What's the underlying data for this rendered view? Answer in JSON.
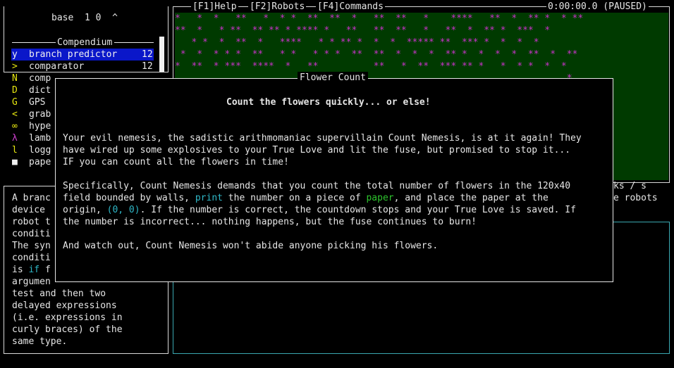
{
  "top_left": {
    "title": "base  1 0  ^"
  },
  "topbar": {
    "help": "[F1]Help",
    "robots": "[F2]Robots",
    "commands": "[F4]Commands",
    "clock": "0:00:00.0 (PAUSED)"
  },
  "compendium": {
    "title": "Compendium",
    "items": [
      {
        "glyph": "y",
        "label": "branch predictor",
        "count": "12"
      },
      {
        "glyph": ">",
        "label": "comparator",
        "count": "12"
      },
      {
        "glyph": "N",
        "label": "comp",
        "count": ""
      },
      {
        "glyph": "D",
        "label": "dict",
        "count": ""
      },
      {
        "glyph": "G",
        "label": "GPS",
        "count": ""
      },
      {
        "glyph": "<",
        "label": "grab",
        "count": ""
      },
      {
        "glyph": "∞",
        "label": "hype",
        "count": ""
      },
      {
        "glyph": "λ",
        "label": "lamb",
        "count": ""
      },
      {
        "glyph": "l",
        "label": "logg",
        "count": ""
      },
      {
        "glyph": "■",
        "label": "pape",
        "count": ""
      }
    ]
  },
  "description": {
    "lines": [
      "A branc",
      "device ",
      "robot t",
      "conditi",
      "The syn",
      "conditi",
      "argumen",
      "test and then two",
      "delayed expressions",
      "(i.e. expressions in",
      "curly braces) of the",
      "same type."
    ],
    "line7_prefix": "is ",
    "line7_keyword": "if",
    "line7_suffix": " f"
  },
  "right_panel": {
    "ticks_fragment": "ks / s",
    "robots_fragment": "e robots"
  },
  "world_grid": {
    "rows": [
      "*   *  *   **   *  * *  **  **  *   **  **   *    ****   **  *  ** *  * **",
      "**  *   * **  ** ** * **** *   **   **  **   *   **  *  ** *  ***  *",
      "   * *  *  **  *   ****   * * ** *  *  *  ***** **  *** *  *  *  *",
      " *  *  * * *  **   * *   * * *  **  **  *  *  *  ** *  *  *  *  **  *  **",
      "*  **  * ***  ****  *   **          **   *  **  *** ** *   *  * *  *  *",
      "                                                                       *",
      "                                                                ***  ***",
      "                                                                *  *****",
      "                                                                  *  *",
      "                                                                ***  *",
      "                                                                **   *",
      "                                                                  ****",
      "                                                                *  *",
      "                                                                  *****"
    ]
  },
  "modal": {
    "title": "Flower Count",
    "heading": "Count the flowers quickly... or else!",
    "para1": [
      "Your evil nemesis, the sadistic arithmomaniac supervillain Count Nemesis, is at it again! They",
      "have wired up some explosives to your True Love and lit the fuse, but promised to stop it...",
      "IF you can count all the flowers in time!"
    ],
    "para2_line1": "Specifically, Count Nemesis demands that you count the total number of flowers in the 120x40",
    "para2_line2_a": "field bounded by walls, ",
    "para2_line2_print": "print",
    "para2_line2_b": " the number on a piece of ",
    "para2_line2_paper": "paper",
    "para2_line2_c": ", and place the paper at the",
    "para2_line3_a": "origin, ",
    "para2_line3_coord": "(0, 0)",
    "para2_line3_b": ". If the number is correct, the countdown stops and your True Love is saved. If",
    "para2_line4": "the number is incorrect... nothing happens, but the fuse continues to burn!",
    "para3": "And watch out, Count Nemesis won't abide anyone picking his flowers."
  }
}
